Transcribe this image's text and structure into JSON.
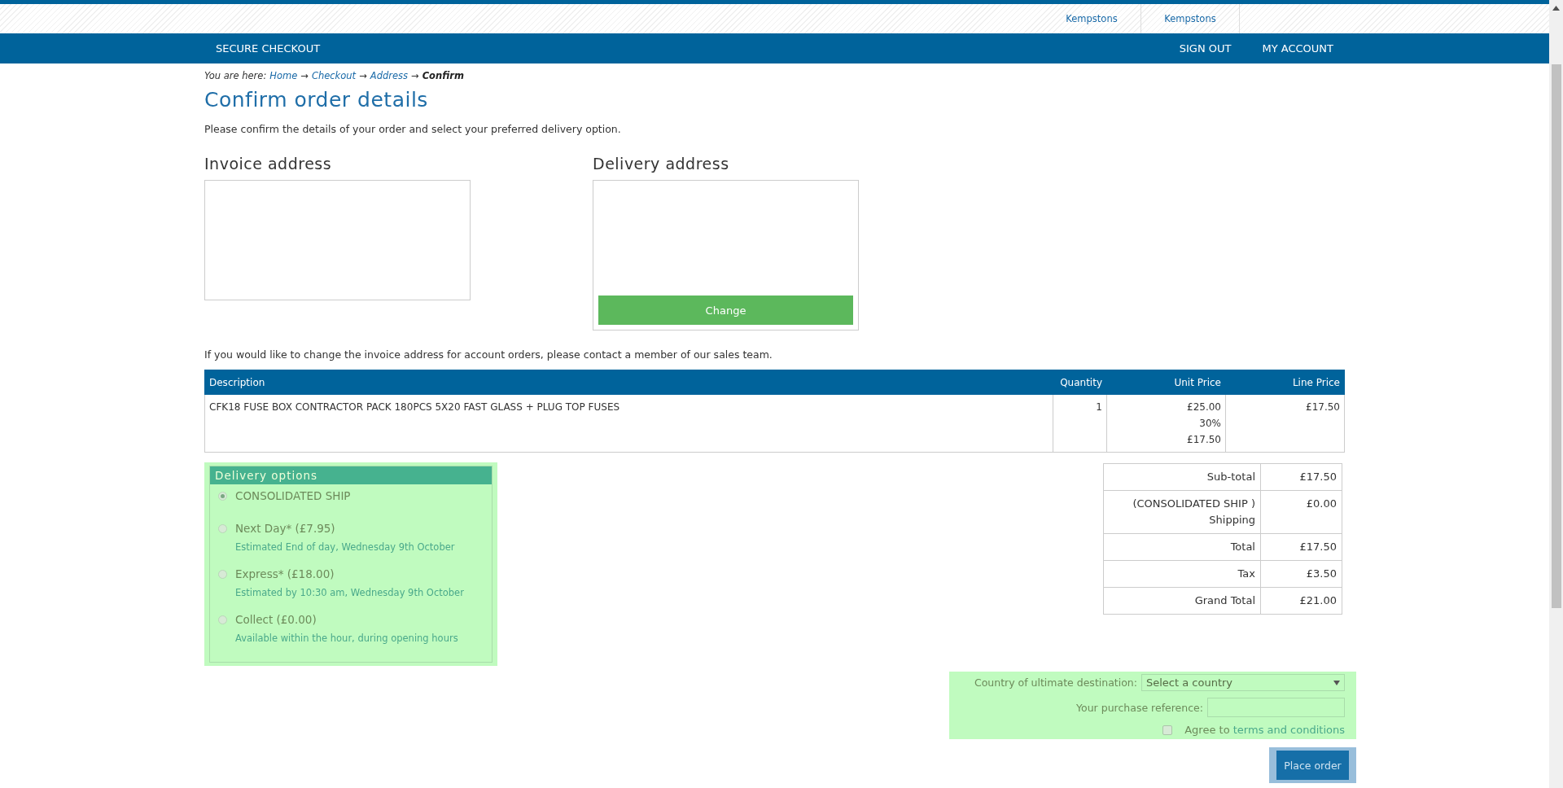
{
  "top_bar": {
    "contacts": [
      "Kempstons",
      "Kempstons"
    ]
  },
  "nav": {
    "title": "SECURE CHECKOUT",
    "links": [
      "SIGN OUT",
      "MY ACCOUNT"
    ]
  },
  "breadcrumb": {
    "prefix": "You are here:",
    "separator": "→",
    "items": [
      {
        "label": "Home",
        "current": false
      },
      {
        "label": "Checkout",
        "current": false
      },
      {
        "label": "Address",
        "current": false
      },
      {
        "label": "Confirm",
        "current": true
      }
    ]
  },
  "page_title": "Confirm order details",
  "intro": "Please confirm the details of your order and select your preferred delivery option.",
  "invoice_address": {
    "heading": "Invoice address"
  },
  "delivery_address": {
    "heading": "Delivery address",
    "button": "Change"
  },
  "invoice_note": "If you would like to change the invoice address for account orders, please contact a member of our sales team.",
  "order_table": {
    "columns": [
      "Description",
      "Quantity",
      "Unit Price",
      "Line Price"
    ],
    "rows": [
      {
        "description": "CFK18 FUSE BOX CONTRACTOR PACK 180PCS 5X20 FAST GLASS + PLUG TOP FUSES",
        "quantity": "1",
        "unit_price": [
          "£25.00",
          "30%",
          "£17.50"
        ],
        "line_price": "£17.50"
      }
    ]
  },
  "delivery_options": {
    "title": "Delivery options",
    "options": [
      {
        "label": "CONSOLIDATED SHIP",
        "selected": true
      },
      {
        "label": "Next Day* (£7.95)",
        "note": "Estimated End of day, Wednesday 9th October",
        "selected": false
      },
      {
        "label": "Express* (£18.00)",
        "note": "Estimated by 10:30 am, Wednesday 9th October",
        "selected": false
      },
      {
        "label": "Collect (£0.00)",
        "note": "Available within the hour, during opening hours",
        "selected": false
      }
    ]
  },
  "totals": [
    {
      "label": [
        "Sub-total"
      ],
      "value": "£17.50"
    },
    {
      "label": [
        "(CONSOLIDATED SHIP )",
        "Shipping"
      ],
      "value": "£0.00"
    },
    {
      "label": [
        "Total"
      ],
      "value": "£17.50"
    },
    {
      "label": [
        "Tax"
      ],
      "value": "£3.50"
    },
    {
      "label": [
        "Grand Total"
      ],
      "value": "£21.00"
    }
  ],
  "checkout_form": {
    "country_label": "Country of ultimate destination:",
    "country_value": "Select a country",
    "reference_label": "Your purchase reference:",
    "agree_prefix": "Agree to",
    "agree_link": "terms and conditions",
    "agree_checked": false,
    "submit": "Place order"
  }
}
